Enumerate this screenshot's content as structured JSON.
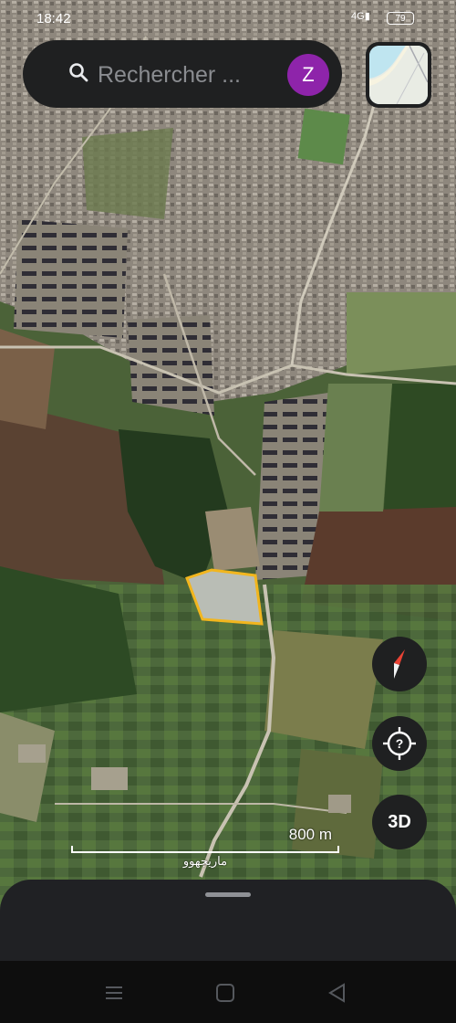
{
  "status_bar": {
    "time": "18:42",
    "signal_label": "4G",
    "battery": "79"
  },
  "search": {
    "placeholder": "Rechercher ...",
    "avatar_letter": "Z",
    "avatar_color": "#8e24aa",
    "icon": "search-icon"
  },
  "map_controls": {
    "layers_icon": "layers-thumbnail-icon",
    "compass_icon": "compass-icon",
    "location_icon": "location-unknown-icon",
    "three_d_label": "3D"
  },
  "scale": {
    "distance": "800 m",
    "place_name": "ماريجهوو"
  },
  "highlight": {
    "outline_color": "#f2b61e"
  },
  "nav_bar": {
    "menu_icon": "recent-apps-icon",
    "home_icon": "home-icon",
    "back_icon": "back-icon"
  }
}
